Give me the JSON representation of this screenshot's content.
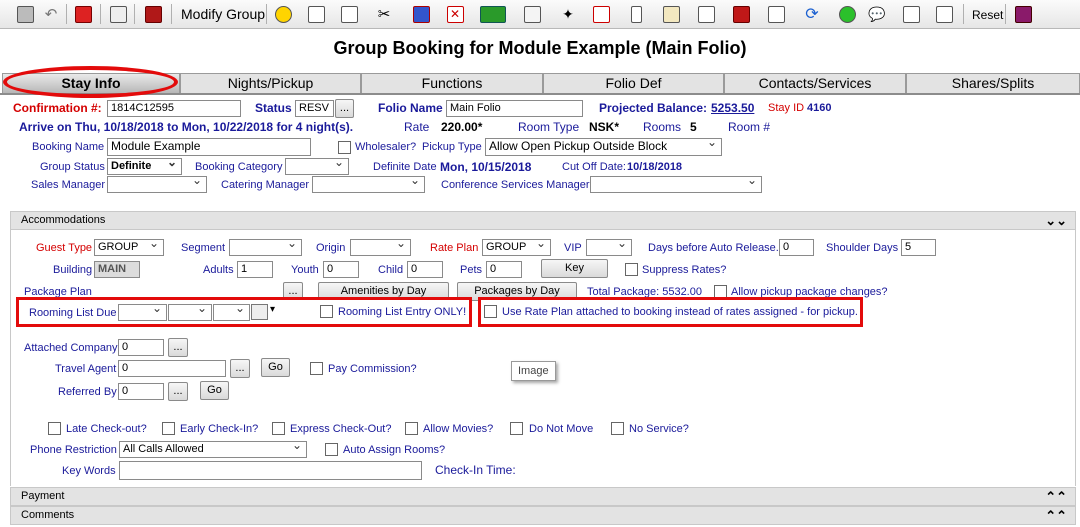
{
  "toolbar": {
    "modify_group_label": "Modify Group",
    "reset_label": "Reset",
    "icons": [
      "save-icon",
      "undo-icon",
      "exit-icon",
      "print-icon",
      "book-icon",
      "smiley-icon",
      "edit-icon",
      "report-icon",
      "scissors-icon",
      "people-icon",
      "cancel-icon",
      "money-icon",
      "copy-icon",
      "wand-icon",
      "phone-icon",
      "mobile-icon",
      "mail-icon",
      "note-icon",
      "tag-icon",
      "checklist-icon",
      "refresh-icon",
      "smile-green-icon",
      "chat-icon",
      "document-icon",
      "notepad-icon",
      "help-book-icon"
    ]
  },
  "page_title": "Group Booking for Module Example (Main Folio)",
  "tabs": [
    {
      "label": "Stay Info",
      "active": true
    },
    {
      "label": "Nights/Pickup"
    },
    {
      "label": "Functions"
    },
    {
      "label": "Folio Def"
    },
    {
      "label": "Contacts/Services"
    },
    {
      "label": "Shares/Splits"
    }
  ],
  "header": {
    "confirmation_label": "Confirmation #:",
    "confirmation_value": "1814C12595",
    "status_label": "Status",
    "status_value": "RESV",
    "status_button": "...",
    "folio_name_label": "Folio Name",
    "folio_name_value": "Main Folio",
    "projected_balance_label": "Projected Balance:",
    "projected_balance_value": "5253.50",
    "stay_id_label": "Stay ID",
    "stay_id_value": "4160",
    "arrive_text": "Arrive on Thu, 10/18/2018 to Mon, 10/22/2018 for 4 night(s).",
    "rate_label": "Rate",
    "rate_value": "220.00*",
    "room_type_label": "Room Type",
    "room_type_value": "NSK*",
    "rooms_label": "Rooms",
    "rooms_value": "5",
    "room_num_label": "Room #",
    "booking_name_label": "Booking Name",
    "booking_name_value": "Module Example",
    "wholesaler_label": "Wholesaler?",
    "pickup_type_label": "Pickup Type",
    "pickup_type_value": "Allow Open Pickup Outside Block",
    "group_status_label": "Group Status",
    "group_status_value": "Definite",
    "booking_category_label": "Booking Category",
    "definite_date_label": "Definite Date",
    "definite_date_value": "Mon, 10/15/2018",
    "cutoff_label": "Cut Off Date:",
    "cutoff_value": "10/18/2018",
    "sales_manager_label": "Sales Manager",
    "catering_manager_label": "Catering Manager",
    "conference_manager_label": "Conference Services Manager"
  },
  "accommodations": {
    "title": "Accommodations",
    "guest_type_label": "Guest Type",
    "guest_type_value": "GROUP",
    "segment_label": "Segment",
    "origin_label": "Origin",
    "rate_plan_label": "Rate Plan",
    "rate_plan_value": "GROUP",
    "vip_label": "VIP",
    "days_auto_release_label": "Days before Auto Release.",
    "days_auto_release_value": "0",
    "shoulder_days_label": "Shoulder Days",
    "shoulder_days_value": "5",
    "building_label": "Building",
    "building_value": "MAIN",
    "adults_label": "Adults",
    "adults_value": "1",
    "youth_label": "Youth",
    "youth_value": "0",
    "child_label": "Child",
    "child_value": "0",
    "pets_label": "Pets",
    "pets_value": "0",
    "key_button": "Key",
    "suppress_rates_label": "Suppress Rates?",
    "package_plan_label": "Package Plan",
    "package_plan_button": "...",
    "amenities_button": "Amenities by Day",
    "packages_button": "Packages by Day",
    "total_package_text": "Total Package: 5532.00",
    "allow_pickup_label": "Allow pickup package changes?",
    "rooming_list_due_label": "Rooming List Due",
    "rooming_list_entry_label": "Rooming List Entry ONLY!",
    "use_rate_plan_label": "Use Rate Plan attached to booking instead of rates assigned - for pickup.",
    "attached_company_label": "Attached Company",
    "attached_company_value": "0",
    "travel_agent_label": "Travel Agent",
    "travel_agent_value": "0",
    "referred_by_label": "Referred By",
    "referred_by_value": "0",
    "ellipsis": "...",
    "go_label": "Go",
    "pay_commission_label": "Pay Commission?",
    "tooltip": "Image",
    "late_checkout_label": "Late Check-out?",
    "early_checkin_label": "Early Check-In?",
    "express_checkout_label": "Express Check-Out?",
    "allow_movies_label": "Allow Movies?",
    "do_not_move_label": "Do Not Move",
    "no_service_label": "No Service?",
    "phone_restriction_label": "Phone Restriction",
    "phone_restriction_value": "All Calls Allowed",
    "auto_assign_label": "Auto Assign Rooms?",
    "key_words_label": "Key Words",
    "checkin_time_label": "Check-In Time:"
  },
  "payment_title": "Payment",
  "comments_title": "Comments",
  "colors": {
    "accent_red": "#e30b0b",
    "label_blue": "#1a1a9a"
  }
}
